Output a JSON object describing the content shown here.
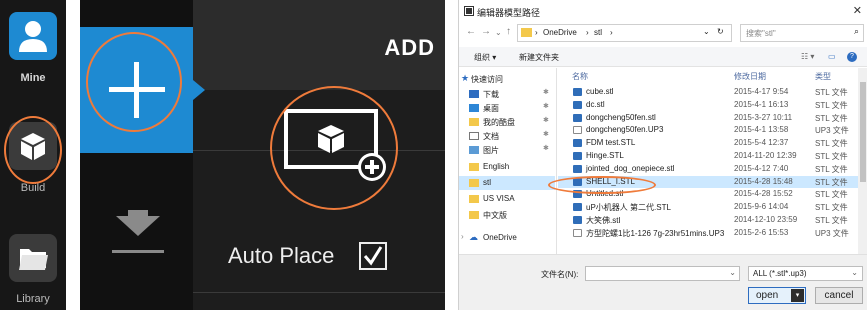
{
  "sidebar": {
    "items": [
      {
        "label": "Mine",
        "icon": "person-icon"
      },
      {
        "label": "Build",
        "icon": "cube-icon"
      },
      {
        "label": "Library",
        "icon": "folder-icon"
      }
    ]
  },
  "add_panel": {
    "title": "ADD",
    "auto_place_label": "Auto Place",
    "auto_place_checked": true
  },
  "dialog": {
    "title": "编辑器模型路径",
    "breadcrumb": [
      "OneDrive",
      "stl"
    ],
    "search_placeholder": "搜索\"stl\"",
    "toolbar": {
      "organize": "组织 ▾",
      "new_folder": "新建文件夹"
    },
    "nav": [
      {
        "label": "快速访问"
      },
      {
        "label": "下载"
      },
      {
        "label": "桌面"
      },
      {
        "label": "我的酷盘"
      },
      {
        "label": "文档"
      },
      {
        "label": "图片"
      },
      {
        "label": "English"
      },
      {
        "label": "stl"
      },
      {
        "label": "US VISA"
      },
      {
        "label": "中文版"
      },
      {
        "label": "OneDrive"
      }
    ],
    "columns": {
      "name": "名称",
      "date": "修改日期",
      "type": "类型"
    },
    "files": [
      {
        "name": "cube.stl",
        "date": "2015-4-17 9:54",
        "type": "STL 文件",
        "icon": "stl"
      },
      {
        "name": "dc.stl",
        "date": "2015-4-1 16:13",
        "type": "STL 文件",
        "icon": "stl"
      },
      {
        "name": "dongcheng50fen.stl",
        "date": "2015-3-27 10:11",
        "type": "STL 文件",
        "icon": "stl"
      },
      {
        "name": "dongcheng50fen.UP3",
        "date": "2015-4-1 13:58",
        "type": "UP3 文件",
        "icon": "doc"
      },
      {
        "name": "FDM test.STL",
        "date": "2015-5-4 12:37",
        "type": "STL 文件",
        "icon": "stl"
      },
      {
        "name": "Hinge.STL",
        "date": "2014-11-20 12:39",
        "type": "STL 文件",
        "icon": "stl"
      },
      {
        "name": "jointed_dog_onepiece.stl",
        "date": "2015-4-12 7:40",
        "type": "STL 文件",
        "icon": "stl"
      },
      {
        "name": "SHELL_I.STL",
        "date": "2015-4-28 15:48",
        "type": "STL 文件",
        "icon": "stl",
        "selected": true
      },
      {
        "name": "Untitled.stl",
        "date": "2015-4-28 15:52",
        "type": "STL 文件",
        "icon": "stl"
      },
      {
        "name": "uP小机器人 第二代.STL",
        "date": "2015-9-6 14:04",
        "type": "STL 文件",
        "icon": "stl"
      },
      {
        "name": "大笑佛.stl",
        "date": "2014-12-10 23:59",
        "type": "STL 文件",
        "icon": "stl"
      },
      {
        "name": "方型陀螺1比1-126 7g-23hr51mins.UP3",
        "date": "2015-2-6 15:53",
        "type": "UP3 文件",
        "icon": "doc"
      }
    ],
    "filename_label": "文件名(N):",
    "filename_value": "",
    "filter_value": "ALL (*.stl*.up3)",
    "open_label": "open",
    "cancel_label": "cancel"
  },
  "colors": {
    "accent": "#1e8ad2",
    "highlight_ring": "#ef7b3b"
  }
}
